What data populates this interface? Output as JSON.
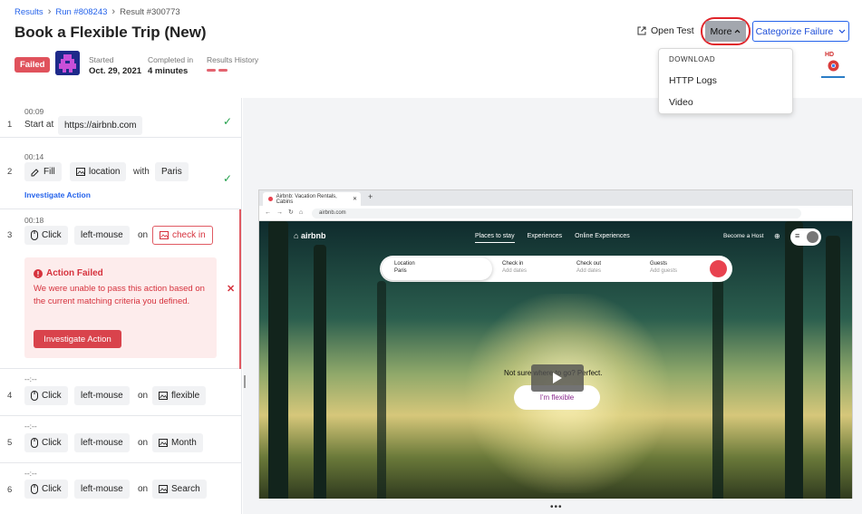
{
  "breadcrumb": {
    "root": "Results",
    "run": "Run #808243",
    "current": "Result #300773"
  },
  "title": "Book a Flexible Trip (New)",
  "status": "Failed",
  "meta": {
    "started_label": "Started",
    "started_value": "Oct. 29, 2021",
    "completed_label": "Completed in",
    "completed_value": "4 minutes",
    "history_label": "Results History"
  },
  "toolbar": {
    "open_test": "Open Test",
    "more": "More",
    "categorize": "Categorize Failure"
  },
  "hd_badge": "HD",
  "dropdown": {
    "heading": "DOWNLOAD",
    "items": [
      "HTTP Logs",
      "Video"
    ]
  },
  "steps": [
    {
      "num": "1",
      "time": "00:09",
      "action": "Start at",
      "target": "https://airbnb.com"
    },
    {
      "num": "2",
      "time": "00:14",
      "action": "Fill",
      "target": "location",
      "with": "with",
      "value": "Paris",
      "link": "Investigate Action"
    },
    {
      "num": "3",
      "time": "00:18",
      "action": "Click",
      "button": "left-mouse",
      "on": "on",
      "target": "check in"
    },
    {
      "num": "4",
      "time": "--:--",
      "action": "Click",
      "button": "left-mouse",
      "on": "on",
      "target": "flexible"
    },
    {
      "num": "5",
      "time": "--:--",
      "action": "Click",
      "button": "left-mouse",
      "on": "on",
      "target": "Month"
    },
    {
      "num": "6",
      "time": "--:--",
      "action": "Click",
      "button": "left-mouse",
      "on": "on",
      "target": "Search"
    }
  ],
  "failure": {
    "title": "Action Failed",
    "message": "We were unable to pass this action based on the current matching criteria you defined.",
    "button": "Investigate Action"
  },
  "browser": {
    "tab_title": "Airbnb: Vacation Rentals, Cabins",
    "url": "airbnb.com",
    "brand": "airbnb",
    "nav": [
      "Places to stay",
      "Experiences",
      "Online Experiences"
    ],
    "become_host": "Become a Host",
    "search": {
      "location_label": "Location",
      "location_value": "Paris",
      "checkin_label": "Check in",
      "checkin_placeholder": "Add dates",
      "checkout_label": "Check out",
      "checkout_placeholder": "Add dates",
      "guests_label": "Guests",
      "guests_placeholder": "Add guests"
    },
    "hero_text": "Not sure where to go? Perfect.",
    "flex_button": "I'm flexible"
  }
}
